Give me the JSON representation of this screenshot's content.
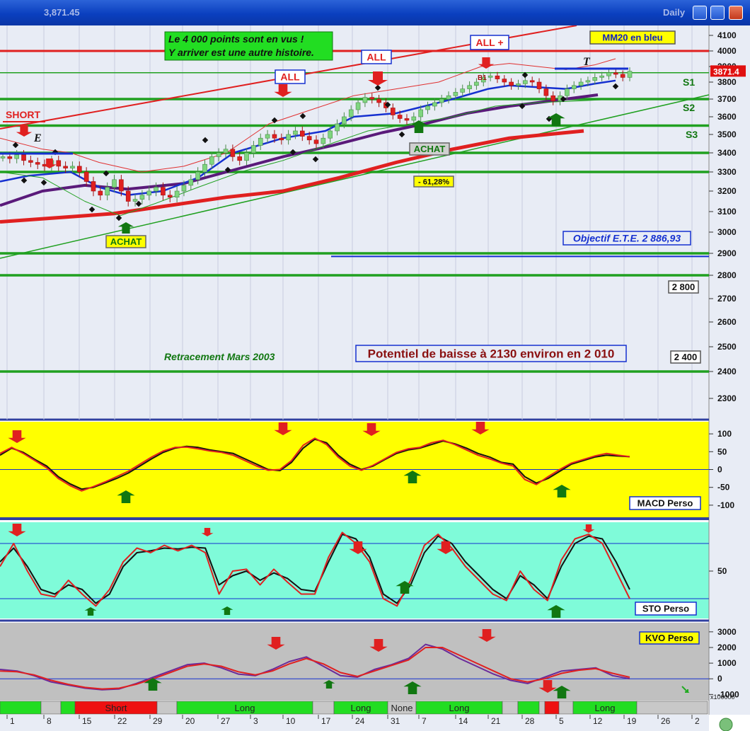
{
  "window": {
    "title_value": "3,871.45",
    "timeframe": "Daily"
  },
  "chart_data": [
    {
      "type": "candlestick",
      "y_axis": {
        "ticks": [
          4100,
          4000,
          3900,
          3800,
          3700,
          3600,
          3500,
          3400,
          3300,
          3200,
          3100,
          3000,
          2900,
          2800,
          2700,
          2600,
          2500,
          2400,
          2300
        ]
      },
      "last_price": "3871.4",
      "horizontal_levels": [
        {
          "value": 4000,
          "color": "#e02020"
        },
        {
          "value": 3860,
          "color": "#20a020"
        },
        {
          "value": 3700,
          "color": "#20a020"
        },
        {
          "value": 3550,
          "color": "#20a020"
        },
        {
          "value": 3400,
          "color": "#20a020"
        },
        {
          "value": 3300,
          "color": "#20a020"
        },
        {
          "value": 2900,
          "color": "#20a020"
        },
        {
          "value": 2800,
          "color": "#20a020"
        },
        {
          "value": 2400,
          "color": "#20a020"
        }
      ],
      "support_labels": [
        "S1",
        "S2",
        "S3"
      ],
      "annotations": {
        "note_line1": "Le 4 000 points sont en vus !",
        "note_line2": "Y arriver est une autre histoire.",
        "mm20": "MM20 en bleu",
        "all_plus": "ALL +",
        "all_1": "ALL",
        "all_2": "ALL",
        "short": "SHORT",
        "achat_1": "ACHAT",
        "achat_2": "ACHAT",
        "fib": "- 61,28%",
        "objectif": "Objectif E.T.E. 2 886,93",
        "level_2800": "2 800",
        "level_2400": "2 400",
        "retracement": "Retracement Mars 2003",
        "potentiel": "Potentiel de baisse à 2130 environ en 2 010",
        "marker_e": "E",
        "marker_t": "T",
        "marker_b1": "B1"
      },
      "colors": {
        "up_candle": "#7fd67f",
        "down_candle": "#e02020",
        "mm20": "#1530d0",
        "ma_purple": "#5a1a7a",
        "ma_red": "#e02020"
      }
    },
    {
      "type": "line",
      "name": "MACD Perso",
      "y_ticks": [
        100,
        50,
        0,
        -50,
        -100
      ],
      "ylim": [
        -130,
        130
      ],
      "series": [
        {
          "color": "#111111",
          "values": [
            40,
            60,
            48,
            28,
            10,
            -20,
            -40,
            -55,
            -50,
            -38,
            -25,
            -10,
            10,
            30,
            48,
            60,
            65,
            62,
            55,
            50,
            45,
            30,
            15,
            0,
            -3,
            20,
            60,
            85,
            75,
            40,
            15,
            0,
            10,
            28,
            45,
            55,
            60,
            70,
            80,
            72,
            60,
            45,
            35,
            20,
            15,
            -20,
            -38,
            -25,
            -5,
            15,
            25,
            35,
            40,
            38,
            36
          ]
        },
        {
          "color": "#e02020",
          "values": [
            45,
            62,
            45,
            25,
            5,
            -25,
            -45,
            -60,
            -48,
            -35,
            -20,
            -5,
            15,
            35,
            52,
            62,
            63,
            58,
            52,
            48,
            40,
            25,
            10,
            -2,
            0,
            25,
            68,
            88,
            70,
            35,
            10,
            -2,
            12,
            30,
            48,
            58,
            62,
            75,
            82,
            70,
            55,
            40,
            30,
            18,
            10,
            -28,
            -42,
            -20,
            0,
            18,
            28,
            38,
            45,
            40,
            36
          ]
        }
      ]
    },
    {
      "type": "line",
      "name": "STO Perso",
      "y_ticks": [
        50
      ],
      "ylim": [
        0,
        100
      ],
      "series": [
        {
          "color": "#111111",
          "values": [
            60,
            75,
            55,
            30,
            25,
            35,
            30,
            15,
            25,
            55,
            70,
            72,
            75,
            74,
            76,
            75,
            35,
            45,
            50,
            40,
            48,
            42,
            30,
            28,
            60,
            90,
            85,
            65,
            25,
            15,
            35,
            70,
            88,
            80,
            60,
            45,
            30,
            20,
            45,
            35,
            20,
            55,
            80,
            88,
            85,
            60,
            30
          ]
        },
        {
          "color": "#e02020",
          "values": [
            55,
            80,
            50,
            25,
            22,
            40,
            25,
            12,
            30,
            60,
            75,
            70,
            78,
            72,
            78,
            70,
            25,
            50,
            52,
            35,
            52,
            38,
            25,
            25,
            65,
            92,
            80,
            60,
            20,
            12,
            40,
            78,
            90,
            75,
            55,
            40,
            25,
            18,
            50,
            30,
            18,
            62,
            85,
            90,
            80,
            50,
            20
          ]
        }
      ]
    },
    {
      "type": "line",
      "name": "KVO Perso",
      "y_ticks": [
        3000,
        2000,
        1000,
        0,
        -1000
      ],
      "ylim": [
        -1300,
        3400
      ],
      "y_multiplier_label": "x100000",
      "series": [
        {
          "color": "#6a2a9a",
          "values": [
            600,
            500,
            200,
            -200,
            -400,
            -600,
            -700,
            -650,
            -300,
            100,
            500,
            900,
            1000,
            700,
            300,
            200,
            600,
            1100,
            1400,
            800,
            200,
            100,
            600,
            900,
            1300,
            2200,
            1900,
            1300,
            800,
            300,
            -100,
            -300,
            100,
            500,
            600,
            700,
            200,
            0
          ]
        },
        {
          "color": "#e02020",
          "values": [
            500,
            450,
            250,
            -100,
            -350,
            -550,
            -650,
            -600,
            -350,
            0,
            400,
            800,
            950,
            800,
            450,
            250,
            500,
            950,
            1300,
            950,
            400,
            150,
            500,
            850,
            1200,
            2000,
            2000,
            1500,
            1000,
            500,
            0,
            -200,
            0,
            350,
            550,
            650,
            350,
            100
          ]
        }
      ]
    }
  ],
  "timeline": {
    "signal_segments": [
      {
        "label": "",
        "color": "#22dd22",
        "from": 0,
        "to": 58
      },
      {
        "label": "",
        "color": "#c8c8c8",
        "from": 58,
        "to": 86
      },
      {
        "label": "",
        "color": "#22dd22",
        "from": 86,
        "to": 106
      },
      {
        "label": "Short",
        "color": "#ee1111",
        "from": 106,
        "to": 222
      },
      {
        "label": "",
        "color": "#c8c8c8",
        "from": 222,
        "to": 250
      },
      {
        "label": "Long",
        "color": "#22dd22",
        "from": 250,
        "to": 442
      },
      {
        "label": "",
        "color": "#c8c8c8",
        "from": 442,
        "to": 472
      },
      {
        "label": "Long",
        "color": "#22dd22",
        "from": 472,
        "to": 548
      },
      {
        "label": "None",
        "color": "#c8c8c8",
        "from": 548,
        "to": 588
      },
      {
        "label": "Long",
        "color": "#22dd22",
        "from": 588,
        "to": 710
      },
      {
        "label": "",
        "color": "#c8c8c8",
        "from": 710,
        "to": 732
      },
      {
        "label": "",
        "color": "#22dd22",
        "from": 732,
        "to": 762
      },
      {
        "label": "",
        "color": "#c8c8c8",
        "from": 762,
        "to": 770
      },
      {
        "label": "",
        "color": "#ee1111",
        "from": 770,
        "to": 790
      },
      {
        "label": "",
        "color": "#c8c8c8",
        "from": 790,
        "to": 810
      },
      {
        "label": "Long",
        "color": "#22dd22",
        "from": 810,
        "to": 900
      },
      {
        "label": "",
        "color": "#c8c8c8",
        "from": 900,
        "to": 1000
      }
    ],
    "dates": [
      "1",
      "8",
      "15",
      "22",
      "29",
      "20",
      "27",
      "3",
      "10",
      "17",
      "24",
      "31",
      "7",
      "14",
      "21",
      "28",
      "5",
      "12",
      "19",
      "26",
      "2"
    ]
  }
}
